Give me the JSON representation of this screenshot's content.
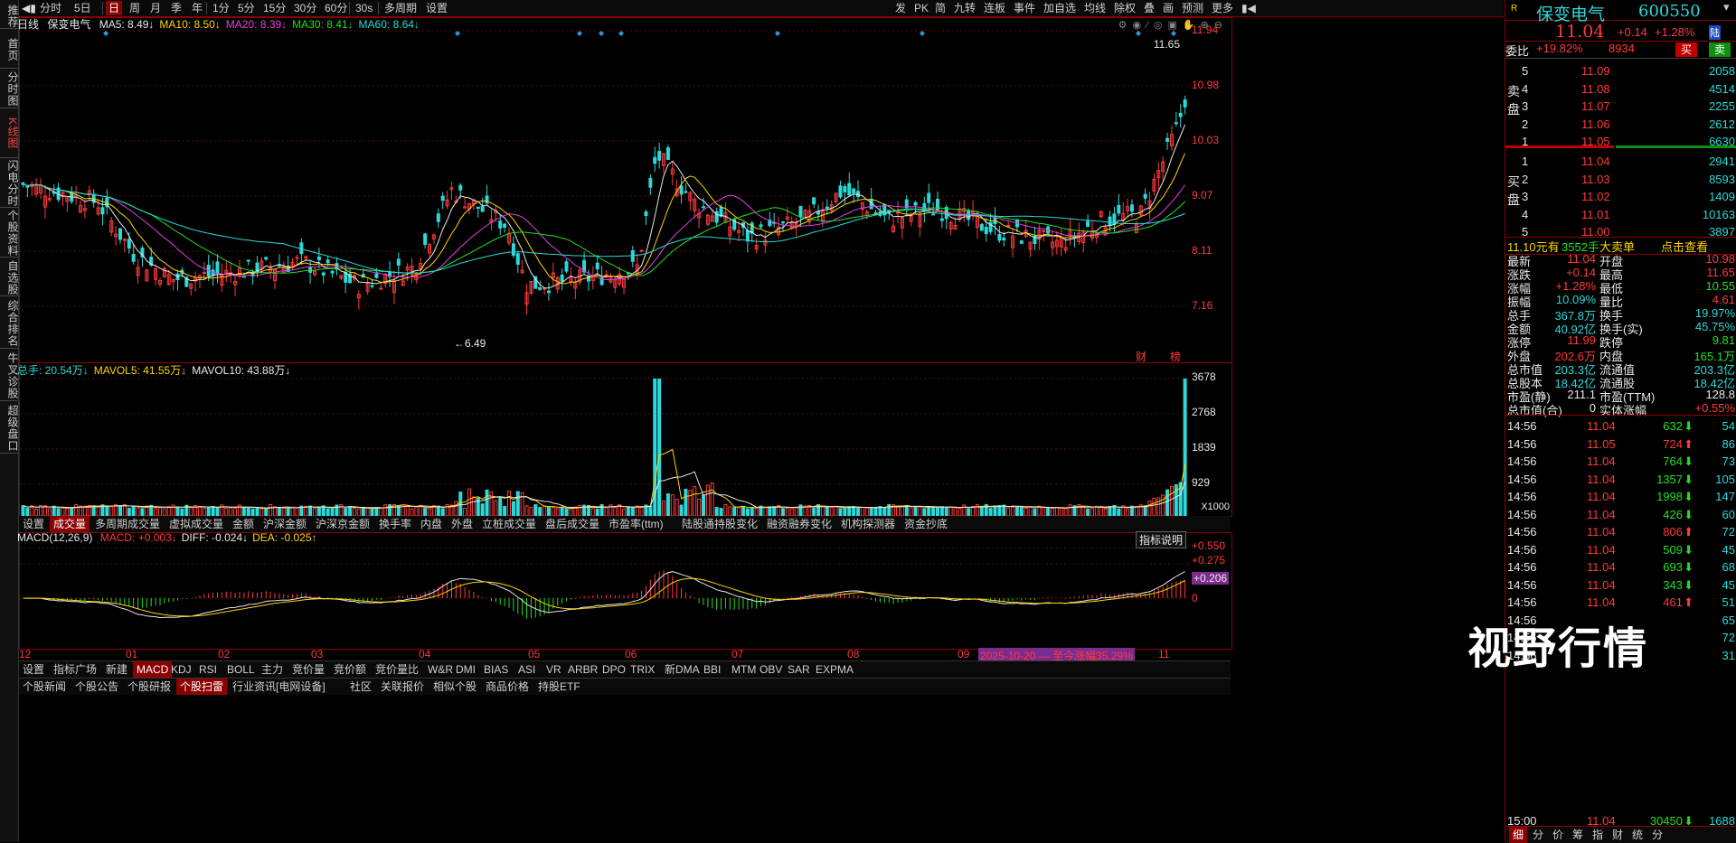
{
  "sidebar": {
    "tabs": [
      {
        "label": "推荐",
        "active": false
      },
      {
        "label": "首页",
        "active": false
      },
      {
        "label": "分时图",
        "active": false
      },
      {
        "label": "K线图",
        "active": true
      },
      {
        "label": "闪电分时",
        "active": false
      },
      {
        "label": "个股资料",
        "active": false
      },
      {
        "label": "自选股",
        "active": false
      },
      {
        "label": "综合排名",
        "active": false
      },
      {
        "label": "牛叉诊股",
        "active": false
      },
      {
        "label": "超级盘口",
        "active": false
      }
    ]
  },
  "toolbar": {
    "items": [
      "分时",
      "5日",
      "日",
      "周",
      "月",
      "季",
      "年",
      "1分",
      "5分",
      "15分",
      "30分",
      "60分",
      "30s",
      "多周期",
      "设置"
    ],
    "active": "日",
    "right_items": [
      "发",
      "PK",
      "简",
      "九转",
      "连板",
      "事件",
      "加自选",
      "均线",
      "除权",
      "叠",
      "画",
      "预测",
      "更多"
    ]
  },
  "main_chart": {
    "period": "日线",
    "stock": "保变电气",
    "ma_labels": [
      {
        "text": "MA5: 8.49↓",
        "color": "#e8e8e8"
      },
      {
        "text": "MA10: 8.50↓",
        "color": "#ffd400"
      },
      {
        "text": "MA20: 8.39↓",
        "color": "#e040e0"
      },
      {
        "text": "MA30: 8.41↓",
        "color": "#20e020"
      },
      {
        "text": "MA60: 8.64↓",
        "color": "#2bd9d9"
      }
    ],
    "y_ticks": [
      "11.94",
      "10.98",
      "10.03",
      "9.07",
      "8.11",
      "7.16"
    ],
    "high_label": "11.65",
    "low_label": "6.49",
    "tags": [
      "财",
      "榜"
    ]
  },
  "volume_chart": {
    "labels": [
      {
        "text": "总手: 20.54万↓",
        "color": "#2bd9d9"
      },
      {
        "text": "MAVOL5: 41.55万↓",
        "color": "#ffd400"
      },
      {
        "text": "MAVOL10: 43.88万↓",
        "color": "#e8e8e8"
      }
    ],
    "y_ticks": [
      "3678",
      "2768",
      "1839",
      "929"
    ],
    "unit": "X1000"
  },
  "indicator_tabs": [
    "设置",
    "成交量",
    "多周期成交量",
    "虚拟成交量",
    "金额",
    "沪深金额",
    "沪深京金额",
    "换手率",
    "内盘",
    "外盘",
    "立桩成交量",
    "盘后成交量",
    "市盈率(ttm)",
    "陆股通持股变化",
    "融资融券变化",
    "机构探测器",
    "资金抄底"
  ],
  "indicator_tabs_active": "成交量",
  "macd_chart": {
    "title": "MACD(12,26,9)",
    "labels": [
      {
        "text": "MACD: +0.003↓",
        "color": "#ff3a3a"
      },
      {
        "text": "DIFF: -0.024↓",
        "color": "#e8e8e8"
      },
      {
        "text": "DEA: -0.025↑",
        "color": "#ffd400"
      }
    ],
    "help_button": "指标说明",
    "y_ticks": [
      "+0.550",
      "+0.275",
      "+0.206",
      "0"
    ],
    "x_ticks": [
      "12",
      "01",
      "02",
      "03",
      "04",
      "05",
      "06",
      "07",
      "08",
      "09",
      "11"
    ],
    "promo": "2025-10-20 — 至今涨幅35.29%"
  },
  "bottom_tabs": [
    "设置",
    "指标广场",
    "新建",
    "MACD",
    "KDJ",
    "RSI",
    "BOLL",
    "主力",
    "竞价量",
    "竞价额",
    "竞价量比",
    "W&R",
    "DMI",
    "BIAS",
    "ASI",
    "VR",
    "ARBR",
    "DPO",
    "TRIX",
    "新DMA",
    "BBI",
    "MTM",
    "OBV",
    "SAR",
    "EXPMA"
  ],
  "bottom_tabs_active": "MACD",
  "news_tabs": [
    "个股新闻",
    "个股公告",
    "个股研报",
    "个股扫雷",
    "行业资讯[电网设备]",
    "社区",
    "关联报价",
    "相似个股",
    "商品价格",
    "持股ETF"
  ],
  "news_active": "个股扫雷",
  "quote": {
    "name": "保变电气",
    "code": "600550",
    "price": "11.04",
    "change": "+0.14",
    "pct": "+1.28%",
    "tag": "陆",
    "webi": "委比",
    "webi_val": "+19.82%",
    "webi_diff": "8934",
    "buy_btn": "买",
    "sell_btn": "卖",
    "sell_label": "卖盘",
    "buy_label": "买盘",
    "asks": [
      {
        "lvl": "5",
        "price": "11.09",
        "vol": "2058"
      },
      {
        "lvl": "4",
        "price": "11.08",
        "vol": "4514"
      },
      {
        "lvl": "3",
        "price": "11.07",
        "vol": "2255"
      },
      {
        "lvl": "2",
        "price": "11.06",
        "vol": "2612"
      },
      {
        "lvl": "1",
        "price": "11.05",
        "vol": "6630"
      }
    ],
    "bids": [
      {
        "lvl": "1",
        "price": "11.04",
        "vol": "2941"
      },
      {
        "lvl": "2",
        "price": "11.03",
        "vol": "8593"
      },
      {
        "lvl": "3",
        "price": "11.02",
        "vol": "1409"
      },
      {
        "lvl": "4",
        "price": "11.01",
        "vol": "10163"
      },
      {
        "lvl": "5",
        "price": "11.00",
        "vol": "3897"
      }
    ],
    "bigorder": {
      "price": "11.10元有",
      "hands": "3552手",
      "label": "大卖单",
      "link": "点击查看"
    },
    "stats": [
      [
        "最新",
        "11.04",
        "red",
        "开盘",
        "10.98",
        "red"
      ],
      [
        "涨跌",
        "+0.14",
        "red",
        "最高",
        "11.65",
        "red"
      ],
      [
        "涨幅",
        "+1.28%",
        "red",
        "最低",
        "10.55",
        "green"
      ],
      [
        "振幅",
        "10.09%",
        "cyan",
        "量比",
        "4.61",
        "red"
      ],
      [
        "总手",
        "367.8万",
        "cyan",
        "换手",
        "19.97%",
        "cyan"
      ],
      [
        "金额",
        "40.92亿",
        "cyan",
        "换手(实)",
        "45.75%",
        "cyan"
      ],
      [
        "涨停",
        "11.99",
        "red",
        "跌停",
        "9.81",
        "green"
      ],
      [
        "外盘",
        "202.6万",
        "red",
        "内盘",
        "165.1万",
        "green"
      ],
      [
        "总市值",
        "203.3亿",
        "cyan",
        "流通值",
        "203.3亿",
        "cyan"
      ],
      [
        "总股本",
        "18.42亿",
        "cyan",
        "流通股",
        "18.42亿",
        "cyan"
      ],
      [
        "市盈(静)",
        "211.1",
        "wht",
        "市盈(TTM)",
        "128.8",
        "wht"
      ],
      [
        "总市值(合)",
        "0",
        "wht",
        "实体涨幅",
        "+0.55%",
        "red"
      ]
    ],
    "ticks": [
      {
        "t": "14:56",
        "p": "11.04",
        "pc": "red",
        "v": "632",
        "dir": "down",
        "n": "54"
      },
      {
        "t": "14:56",
        "p": "11.05",
        "pc": "red",
        "v": "724",
        "dir": "up",
        "n": "86"
      },
      {
        "t": "14:56",
        "p": "11.04",
        "pc": "red",
        "v": "764",
        "dir": "down",
        "n": "73"
      },
      {
        "t": "14:56",
        "p": "11.04",
        "pc": "red",
        "v": "1357",
        "dir": "down",
        "n": "105"
      },
      {
        "t": "14:56",
        "p": "11.04",
        "pc": "red",
        "v": "1998",
        "dir": "down",
        "n": "147"
      },
      {
        "t": "14:56",
        "p": "11.04",
        "pc": "red",
        "v": "426",
        "dir": "down",
        "n": "60"
      },
      {
        "t": "14:56",
        "p": "11.04",
        "pc": "red",
        "v": "806",
        "dir": "up",
        "n": "72"
      },
      {
        "t": "14:56",
        "p": "11.04",
        "pc": "red",
        "v": "509",
        "dir": "down",
        "n": "45"
      },
      {
        "t": "14:56",
        "p": "11.04",
        "pc": "red",
        "v": "693",
        "dir": "down",
        "n": "68"
      },
      {
        "t": "14:56",
        "p": "11.04",
        "pc": "red",
        "v": "343",
        "dir": "down",
        "n": "45"
      },
      {
        "t": "14:56",
        "p": "11.04",
        "pc": "red",
        "v": "461",
        "dir": "up",
        "n": "51"
      },
      {
        "t": "14:56",
        "p": "",
        "pc": "red",
        "v": "",
        "dir": "",
        "n": "65"
      },
      {
        "t": "14:56",
        "p": "",
        "pc": "red",
        "v": "",
        "dir": "",
        "n": "72"
      },
      {
        "t": "14:56",
        "p": "",
        "pc": "red",
        "v": "",
        "dir": "",
        "n": "31"
      },
      {
        "t": "15:00",
        "p": "11.04",
        "pc": "red",
        "v": "30450",
        "dir": "down",
        "n": "1688"
      }
    ],
    "bottom_tabs": [
      "细",
      "分",
      "价",
      "筹",
      "指",
      "财",
      "统",
      "分"
    ],
    "watermark": "视野行情"
  }
}
